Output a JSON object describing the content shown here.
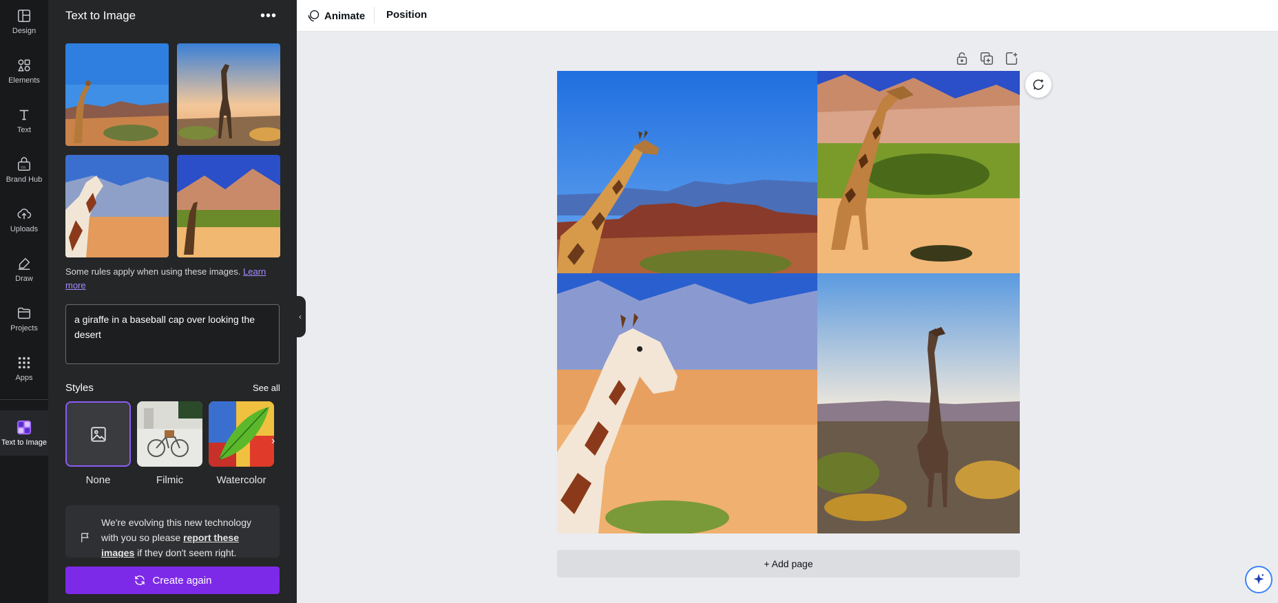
{
  "rail": {
    "items": [
      {
        "label": "Design",
        "icon": "design-icon"
      },
      {
        "label": "Elements",
        "icon": "elements-icon"
      },
      {
        "label": "Text",
        "icon": "text-icon"
      },
      {
        "label": "Brand Hub",
        "icon": "brand-hub-icon"
      },
      {
        "label": "Uploads",
        "icon": "uploads-icon"
      },
      {
        "label": "Draw",
        "icon": "draw-icon"
      },
      {
        "label": "Projects",
        "icon": "projects-icon"
      },
      {
        "label": "Apps",
        "icon": "apps-icon"
      },
      {
        "label": "Text to Image",
        "icon": "text-to-image-icon",
        "active": true
      }
    ]
  },
  "panel": {
    "title": "Text to Image",
    "more": "•••",
    "rules_text": "Some rules apply when using these images.",
    "rules_link": "Learn more",
    "prompt": "a giraffe in a baseball cap over looking the desert",
    "styles_label": "Styles",
    "see_all": "See all",
    "styles": [
      {
        "label": "None",
        "selected": true
      },
      {
        "label": "Filmic"
      },
      {
        "label": "Watercolor"
      }
    ],
    "notice": {
      "text_before": "We're evolving this new technology with you so please ",
      "link": "report these images",
      "text_after": " if they don't seem right."
    },
    "create_again": "Create again"
  },
  "topbar": {
    "animate": "Animate",
    "position": "Position"
  },
  "canvas": {
    "add_page": "+ Add page"
  },
  "colors": {
    "accent": "#7d2ae8",
    "selected_border": "#8b5cf6",
    "link": "#a58cff"
  }
}
